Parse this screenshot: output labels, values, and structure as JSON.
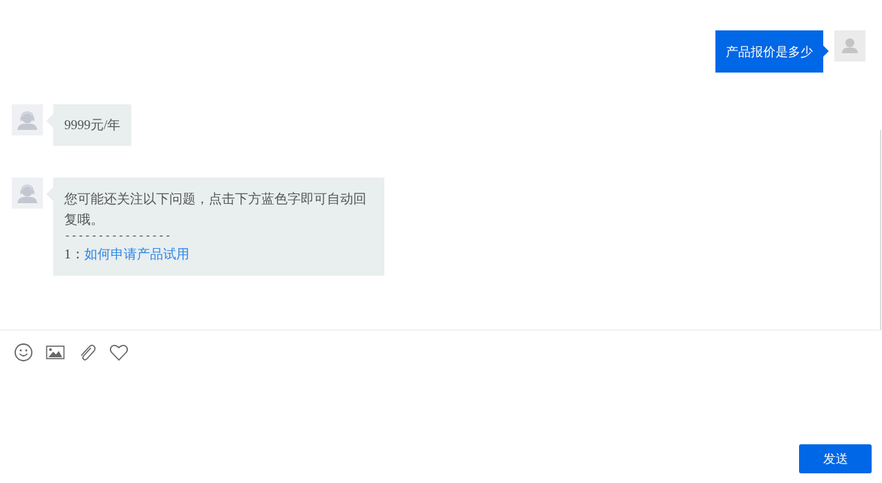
{
  "messages": [
    {
      "kind": "user",
      "text": "产品报价是多少"
    },
    {
      "kind": "agent",
      "text": "9999元/年"
    },
    {
      "kind": "agent",
      "text": "您可能还关注以下问题，点击下方蓝色字即可自动回复哦。",
      "divider": "----------------",
      "links": [
        {
          "number": "1：",
          "label": "如何申请产品试用"
        }
      ]
    }
  ],
  "toolbar": [
    {
      "kind": "emoji"
    },
    {
      "kind": "image"
    },
    {
      "kind": "attachment"
    },
    {
      "kind": "favorite"
    }
  ],
  "send_button": "发送"
}
